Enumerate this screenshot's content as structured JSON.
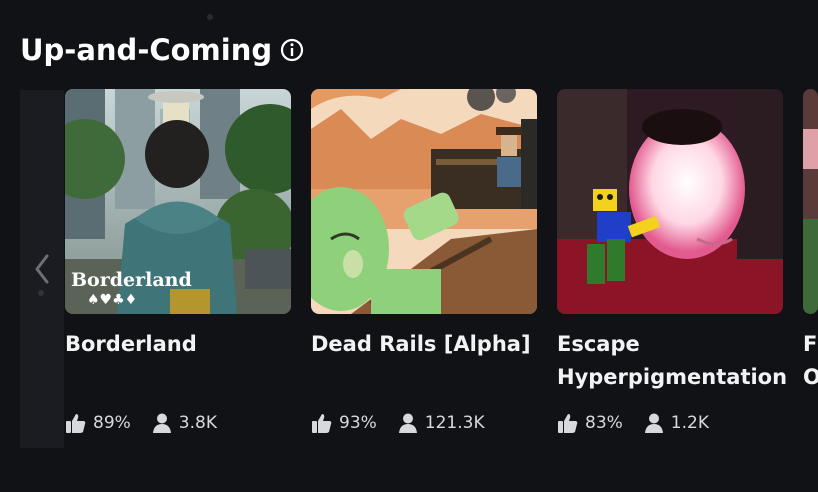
{
  "section": {
    "title": "Up-and-Coming",
    "info_icon": "info-icon"
  },
  "nav": {
    "scroll_left_icon": "chevron-left-icon"
  },
  "games": [
    {
      "title": "Borderland",
      "thumbnail_text": "Borderland",
      "thumbnail_suits": "♠♥♣♦",
      "like_pct": "89%",
      "players": "3.8K"
    },
    {
      "title": "Dead Rails [Alpha]",
      "like_pct": "93%",
      "players": "121.3K"
    },
    {
      "title": "Escape Hyperpigmentation",
      "like_pct": "83%",
      "players": "1.2K"
    },
    {
      "title": "Fi O"
    }
  ],
  "colors": {
    "background": "#111216",
    "text": "#ffffff",
    "stat_text": "#d8d9dc"
  }
}
